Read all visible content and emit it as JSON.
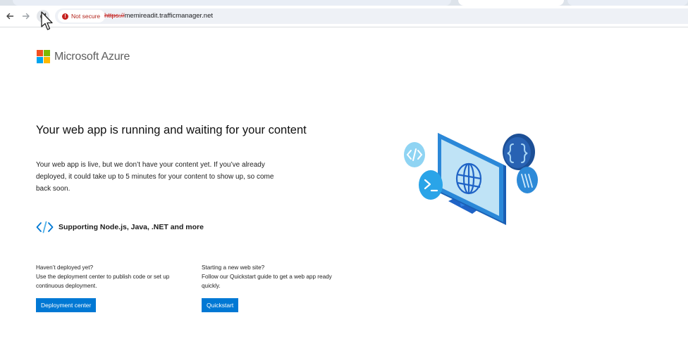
{
  "browser": {
    "security_label": "Not secure",
    "url_scheme": "https://",
    "url_host": "memireadit.trafficmanager.net",
    "icons": [
      "back-icon",
      "forward-icon",
      "reload-icon",
      "not-secure-icon",
      "cursor-icon"
    ]
  },
  "brand": {
    "name": "Microsoft Azure",
    "logo_colors": [
      "#f25022",
      "#7fba00",
      "#00a4ef",
      "#ffb900"
    ]
  },
  "main": {
    "headline": "Your web app is running and waiting for your content",
    "description": "Your web app is live, but we don’t have your content yet. If you’ve already deployed, it could take up to 5 minutes for your content to show up, so come back soon.",
    "supporting": "Supporting Node.js, Java, .NET and more",
    "supporting_icon": "code-brackets-icon"
  },
  "cards": {
    "deploy": {
      "title": "Haven’t deployed yet?",
      "body": "Use the deployment center to publish code or set up continuous deployment.",
      "button": "Deployment center"
    },
    "quickstart": {
      "title": "Starting a new web site?",
      "body": "Follow our Quickstart guide to get a web app ready quickly.",
      "button": "Quickstart"
    }
  },
  "colors": {
    "accent": "#0078d4",
    "not_secure": "#c5221f"
  }
}
